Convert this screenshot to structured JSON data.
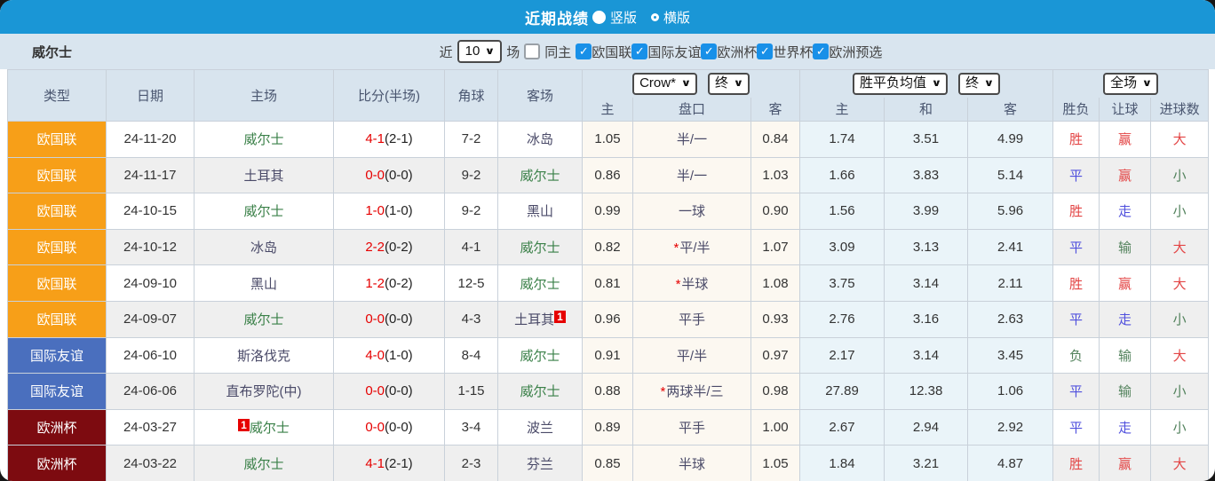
{
  "titlebar": {
    "title": "近期战绩",
    "vertical_label": "竖版",
    "horizontal_label": "横版",
    "selected_layout": "竖版"
  },
  "filter": {
    "team": "威尔士",
    "near_label": "近",
    "count_value": "10",
    "games_label": "场",
    "same_home_label": "同主",
    "same_home_checked": false,
    "check_glyph": "✓",
    "leagues": [
      "欧国联",
      "国际友谊",
      "欧洲杯",
      "世界杯",
      "欧洲预选"
    ]
  },
  "table": {
    "col_headers": {
      "type": "类型",
      "date": "日期",
      "home": "主场",
      "score": "比分(半场)",
      "corner": "角球",
      "away": "客场"
    },
    "selects": {
      "company": "Crow*",
      "company_time": "终",
      "avg": "胜平负均值",
      "avg_time": "终",
      "scope": "全场"
    },
    "sub_headers": [
      "主",
      "盘口",
      "客",
      "主",
      "和",
      "客",
      "胜负",
      "让球",
      "进球数"
    ],
    "rows": [
      {
        "type": "欧国联",
        "tc": "o",
        "date": "24-11-20",
        "home": "威尔士",
        "hself": true,
        "hb": "",
        "score_ft": "4-1",
        "score_ht": "(2-1)",
        "corner": "7-2",
        "away": "冰岛",
        "aself": false,
        "ab": "",
        "odds_home": "1.05",
        "star": false,
        "handicap": "半/一",
        "odds_away": "0.84",
        "avg_home": "1.74",
        "avg_draw": "3.51",
        "avg_away": "4.99",
        "wdl": "胜",
        "wdl_c": "r",
        "let": "赢",
        "let_c": "r",
        "big": "大",
        "big_c": "r"
      },
      {
        "type": "欧国联",
        "tc": "o",
        "date": "24-11-17",
        "home": "土耳其",
        "hself": false,
        "hb": "",
        "score_ft": "0-0",
        "score_ht": "(0-0)",
        "corner": "9-2",
        "away": "威尔士",
        "aself": true,
        "ab": "",
        "odds_home": "0.86",
        "star": false,
        "handicap": "半/一",
        "odds_away": "1.03",
        "avg_home": "1.66",
        "avg_draw": "3.83",
        "avg_away": "5.14",
        "wdl": "平",
        "wdl_c": "b",
        "let": "赢",
        "let_c": "r",
        "big": "小",
        "big_c": "g"
      },
      {
        "type": "欧国联",
        "tc": "o",
        "date": "24-10-15",
        "home": "威尔士",
        "hself": true,
        "hb": "",
        "score_ft": "1-0",
        "score_ht": "(1-0)",
        "corner": "9-2",
        "away": "黑山",
        "aself": false,
        "ab": "",
        "odds_home": "0.99",
        "star": false,
        "handicap": "一球",
        "odds_away": "0.90",
        "avg_home": "1.56",
        "avg_draw": "3.99",
        "avg_away": "5.96",
        "wdl": "胜",
        "wdl_c": "r",
        "let": "走",
        "let_c": "b",
        "big": "小",
        "big_c": "g"
      },
      {
        "type": "欧国联",
        "tc": "o",
        "date": "24-10-12",
        "home": "冰岛",
        "hself": false,
        "hb": "",
        "score_ft": "2-2",
        "score_ht": "(0-2)",
        "corner": "4-1",
        "away": "威尔士",
        "aself": true,
        "ab": "",
        "odds_home": "0.82",
        "star": true,
        "handicap": "平/半",
        "odds_away": "1.07",
        "avg_home": "3.09",
        "avg_draw": "3.13",
        "avg_away": "2.41",
        "wdl": "平",
        "wdl_c": "b",
        "let": "输",
        "let_c": "g",
        "big": "大",
        "big_c": "r"
      },
      {
        "type": "欧国联",
        "tc": "o",
        "date": "24-09-10",
        "home": "黑山",
        "hself": false,
        "hb": "",
        "score_ft": "1-2",
        "score_ht": "(0-2)",
        "corner": "12-5",
        "away": "威尔士",
        "aself": true,
        "ab": "",
        "odds_home": "0.81",
        "star": true,
        "handicap": "半球",
        "odds_away": "1.08",
        "avg_home": "3.75",
        "avg_draw": "3.14",
        "avg_away": "2.11",
        "wdl": "胜",
        "wdl_c": "r",
        "let": "赢",
        "let_c": "r",
        "big": "大",
        "big_c": "r"
      },
      {
        "type": "欧国联",
        "tc": "o",
        "date": "24-09-07",
        "home": "威尔士",
        "hself": true,
        "hb": "",
        "score_ft": "0-0",
        "score_ht": "(0-0)",
        "corner": "4-3",
        "away": "土耳其",
        "aself": false,
        "ab": "1",
        "odds_home": "0.96",
        "star": false,
        "handicap": "平手",
        "odds_away": "0.93",
        "avg_home": "2.76",
        "avg_draw": "3.16",
        "avg_away": "2.63",
        "wdl": "平",
        "wdl_c": "b",
        "let": "走",
        "let_c": "b",
        "big": "小",
        "big_c": "g"
      },
      {
        "type": "国际友谊",
        "tc": "b",
        "date": "24-06-10",
        "home": "斯洛伐克",
        "hself": false,
        "hb": "",
        "score_ft": "4-0",
        "score_ht": "(1-0)",
        "corner": "8-4",
        "away": "威尔士",
        "aself": true,
        "ab": "",
        "odds_home": "0.91",
        "star": false,
        "handicap": "平/半",
        "odds_away": "0.97",
        "avg_home": "2.17",
        "avg_draw": "3.14",
        "avg_away": "3.45",
        "wdl": "负",
        "wdl_c": "g",
        "let": "输",
        "let_c": "g",
        "big": "大",
        "big_c": "r"
      },
      {
        "type": "国际友谊",
        "tc": "b",
        "date": "24-06-06",
        "home": "直布罗陀(中)",
        "hself": false,
        "hb": "",
        "score_ft": "0-0",
        "score_ht": "(0-0)",
        "corner": "1-15",
        "away": "威尔士",
        "aself": true,
        "ab": "",
        "odds_home": "0.88",
        "star": true,
        "handicap": "两球半/三",
        "odds_away": "0.98",
        "avg_home": "27.89",
        "avg_draw": "12.38",
        "avg_away": "1.06",
        "wdl": "平",
        "wdl_c": "b",
        "let": "输",
        "let_c": "g",
        "big": "小",
        "big_c": "g"
      },
      {
        "type": "欧洲杯",
        "tc": "m",
        "date": "24-03-27",
        "home": "威尔士",
        "hself": true,
        "hb": "1",
        "score_ft": "0-0",
        "score_ht": "(0-0)",
        "corner": "3-4",
        "away": "波兰",
        "aself": false,
        "ab": "",
        "odds_home": "0.89",
        "star": false,
        "handicap": "平手",
        "odds_away": "1.00",
        "avg_home": "2.67",
        "avg_draw": "2.94",
        "avg_away": "2.92",
        "wdl": "平",
        "wdl_c": "b",
        "let": "走",
        "let_c": "b",
        "big": "小",
        "big_c": "g"
      },
      {
        "type": "欧洲杯",
        "tc": "m",
        "date": "24-03-22",
        "home": "威尔士",
        "hself": true,
        "hb": "",
        "score_ft": "4-1",
        "score_ht": "(2-1)",
        "corner": "2-3",
        "away": "芬兰",
        "aself": false,
        "ab": "",
        "odds_home": "0.85",
        "star": false,
        "handicap": "半球",
        "odds_away": "1.05",
        "avg_home": "1.84",
        "avg_draw": "3.21",
        "avg_away": "4.87",
        "wdl": "胜",
        "wdl_c": "r",
        "let": "赢",
        "let_c": "r",
        "big": "大",
        "big_c": "r"
      }
    ]
  },
  "colors": {
    "header_blue": "#1a96d6",
    "panel_bg": "#d9e5ef",
    "table_head_bg": "#d8e4ee",
    "league_nations_orange": "#f79f18",
    "friendly_blue": "#4a6fbe",
    "eurocup_maroon": "#7d0b10",
    "win_red": "#e34545",
    "draw_blue": "#5050dd",
    "lose_green": "#52825c",
    "score_red": "#e60000",
    "self_team_green": "#3a8048",
    "odds_cream_bg": "#fcf8f1",
    "avg_blue_bg": "#eaf4f9",
    "zebra_gray": "#efefef",
    "checkbox_blue": "#1890e8",
    "badge_red": "#e60000"
  }
}
